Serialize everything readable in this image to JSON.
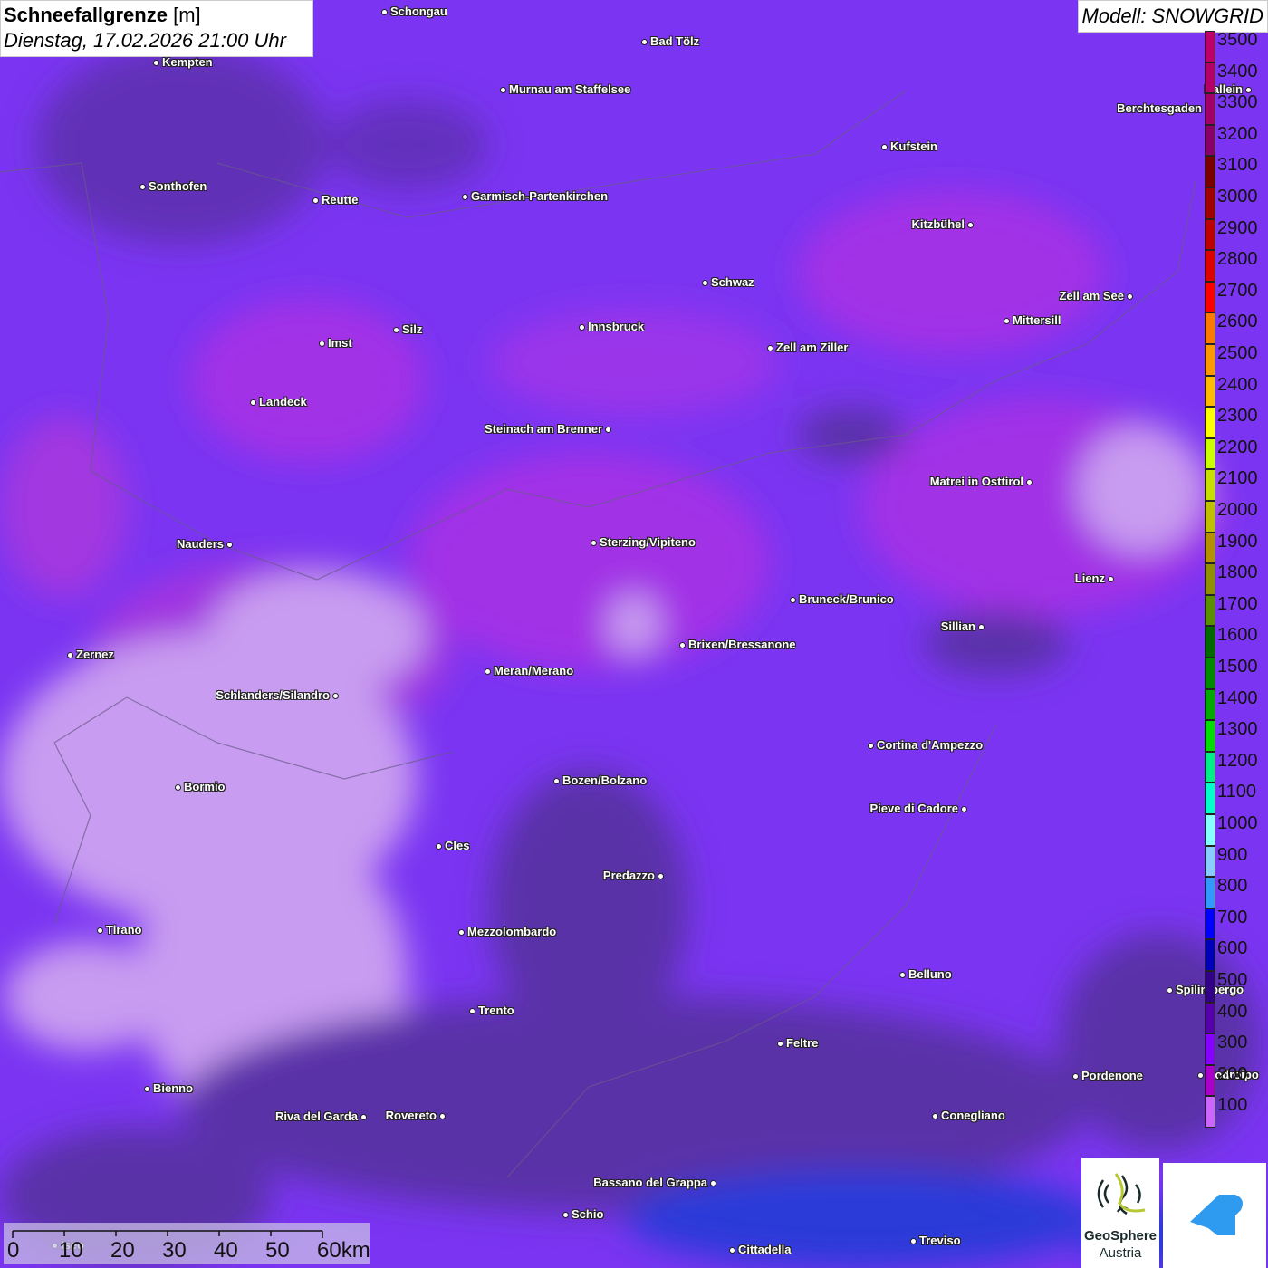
{
  "header": {
    "title_bold": "Schneefallgrenze",
    "title_unit": "[m]",
    "datetime": "Dienstag, 17.02.2026 21:00 Uhr",
    "model": "Modell: SNOWGRID"
  },
  "legend": {
    "labels": [
      "3500",
      "3400",
      "3300",
      "3200",
      "3100",
      "3000",
      "2900",
      "2800",
      "2700",
      "2600",
      "2500",
      "2400",
      "2300",
      "2200",
      "2100",
      "2000",
      "1900",
      "1800",
      "1700",
      "1600",
      "1500",
      "1400",
      "1300",
      "1200",
      "1100",
      "1000",
      "900",
      "800",
      "700",
      "600",
      "500",
      "400",
      "300",
      "200",
      "100"
    ],
    "colors": [
      "#c0006a",
      "#b5006a",
      "#a3006a",
      "#8a006a",
      "#7a0000",
      "#a00000",
      "#bf0000",
      "#df0000",
      "#ff0000",
      "#ff7a00",
      "#ff9900",
      "#ffbb00",
      "#ffff00",
      "#ccff00",
      "#c8e000",
      "#c0c000",
      "#b59000",
      "#909000",
      "#5a9000",
      "#006a00",
      "#008a00",
      "#00aa00",
      "#00dd00",
      "#00ee88",
      "#00ffcc",
      "#88ffff",
      "#88ccff",
      "#3399ff",
      "#0000ff",
      "#0000bb",
      "#330088",
      "#5500aa",
      "#8800ff",
      "#aa00cc",
      "#cc66ff"
    ]
  },
  "cities": [
    "Schongau",
    "Bad Tölz",
    "Kempten",
    "Murnau am Staffelsee",
    "Hallein",
    "Berchtesgaden",
    "Kufstein",
    "Sonthofen",
    "Reutte",
    "Garmisch-Partenkirchen",
    "Kitzbühel",
    "Schwaz",
    "Zell am See",
    "Mittersill",
    "Imst",
    "Silz",
    "Innsbruck",
    "Zell am Ziller",
    "Landeck",
    "Steinach am Brenner",
    "Matrei in Osttirol",
    "Nauders",
    "Sterzing/Vipiteno",
    "Lienz",
    "Bruneck/Brunico",
    "Sillian",
    "Zernez",
    "Brixen/Bressanone",
    "Meran/Merano",
    "Schlanders/Silandro",
    "Cortina d'Ampezzo",
    "Bozen/Bolzano",
    "Pieve di Cadore",
    "Bormio",
    "Cles",
    "Predazzo",
    "Tirano",
    "Mezzolombardo",
    "Belluno",
    "Spilimbergo",
    "Trento",
    "Feltre",
    "Pordenone",
    "Codroipo",
    "Bienno",
    "Riva del Garda",
    "Rovereto",
    "Conegliano",
    "Bassano del Grappa",
    "Schio",
    "Treviso",
    "Cittadella",
    "Iseo"
  ],
  "scale": {
    "labels": [
      "0",
      "10",
      "20",
      "30",
      "40",
      "50",
      "60km"
    ]
  },
  "logos": {
    "geosphere": "GeoSphere",
    "austria": "Austria"
  }
}
